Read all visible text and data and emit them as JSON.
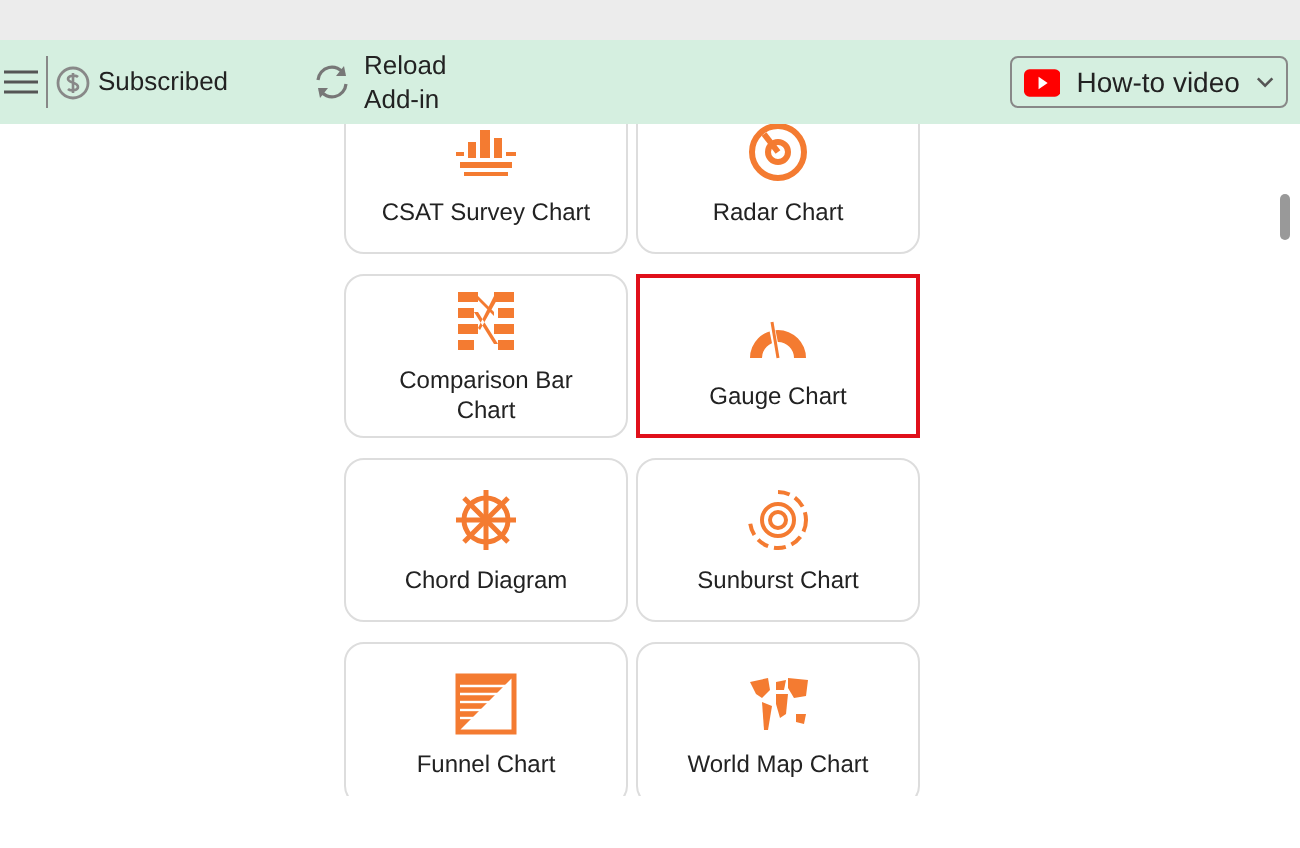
{
  "toolbar": {
    "subscription": "Subscribed",
    "reload": "Reload Add-in",
    "video_button": "How-to video"
  },
  "charts": [
    {
      "label": "CSAT Survey Chart",
      "selected": false
    },
    {
      "label": "Radar Chart",
      "selected": false
    },
    {
      "label": "Comparison Bar Chart",
      "selected": false
    },
    {
      "label": "Gauge Chart",
      "selected": true
    },
    {
      "label": "Chord Diagram",
      "selected": false
    },
    {
      "label": "Sunburst Chart",
      "selected": false
    },
    {
      "label": "Funnel Chart",
      "selected": false
    },
    {
      "label": "World Map Chart",
      "selected": false
    }
  ]
}
